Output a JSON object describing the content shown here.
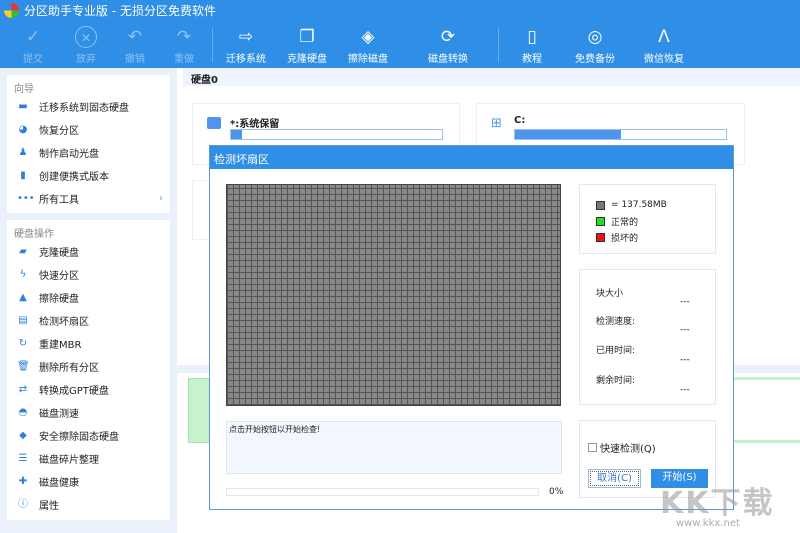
{
  "window": {
    "title": "分区助手专业版 - 无损分区免费软件"
  },
  "toolbar": [
    {
      "label": "提交",
      "icon": "check-icon",
      "enabled": false
    },
    {
      "label": "放弃",
      "icon": "discard-icon",
      "enabled": false
    },
    {
      "label": "撤销",
      "icon": "undo-icon",
      "enabled": false
    },
    {
      "label": "重做",
      "icon": "redo-icon",
      "enabled": false
    },
    {
      "label": "迁移系统",
      "icon": "migrate-icon",
      "enabled": true
    },
    {
      "label": "克隆硬盘",
      "icon": "clone-icon",
      "enabled": true
    },
    {
      "label": "擦除磁盘",
      "icon": "wipe-icon",
      "enabled": true
    },
    {
      "label": "磁盘转换",
      "icon": "convert-icon",
      "enabled": true
    },
    {
      "label": "教程",
      "icon": "book-icon",
      "enabled": true
    },
    {
      "label": "免费备份",
      "icon": "backup-icon",
      "enabled": true
    },
    {
      "label": "微信恢复",
      "icon": "recover-icon",
      "enabled": true
    }
  ],
  "sidebar": {
    "wizard": {
      "title": "向导",
      "items": [
        "迁移系统到固态硬盘",
        "恢复分区",
        "制作启动光盘",
        "创建便携式版本",
        "所有工具"
      ]
    },
    "disk_ops": {
      "title": "硬盘操作",
      "items": [
        "克隆硬盘",
        "快速分区",
        "擦除硬盘",
        "检测坏扇区",
        "重建MBR",
        "删除所有分区",
        "转换成GPT硬盘",
        "磁盘测速",
        "安全擦除固态硬盘",
        "磁盘碎片整理",
        "磁盘健康",
        "属性"
      ]
    }
  },
  "main": {
    "disk_label": "硬盘0",
    "partitions": [
      {
        "name": "*:系统保留",
        "usage": 0.05
      },
      {
        "name": "C:",
        "usage": 0.5
      }
    ]
  },
  "dialog": {
    "title": "检测坏扇区",
    "legend": [
      {
        "label": "= 137.58MB",
        "color": "#777777"
      },
      {
        "label": "正常的",
        "color": "#22dd22"
      },
      {
        "label": "损坏的",
        "color": "#ee1111"
      }
    ],
    "stats": [
      {
        "label": "块大小",
        "value": "---"
      },
      {
        "label": "检测速度:",
        "value": "---"
      },
      {
        "label": "已用时间:",
        "value": "---"
      },
      {
        "label": "剩余时间:",
        "value": "---"
      }
    ],
    "message": "点击开始按钮以开始检查!",
    "progress": 0,
    "progress_text": "0%",
    "quick_check": "快速检测(Q)",
    "cancel": "取消(C)",
    "start": "开始(S)"
  },
  "watermark": {
    "text": "KK下载",
    "url": "www.kkx.net"
  }
}
